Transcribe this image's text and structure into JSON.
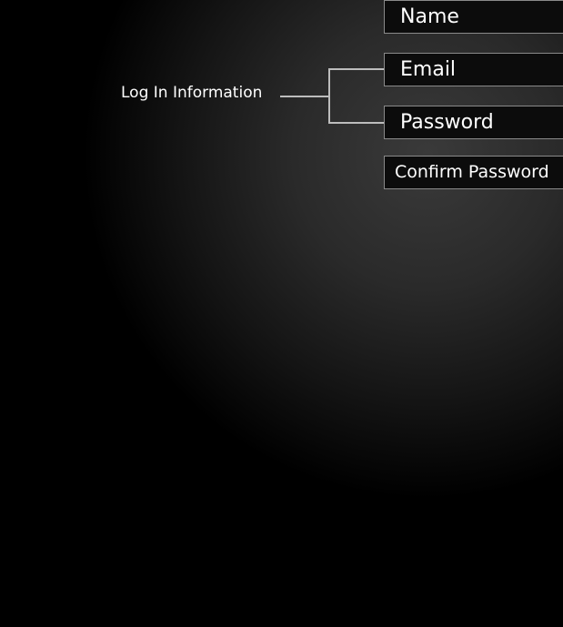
{
  "fields": [
    {
      "label": "Name"
    },
    {
      "label": "Email"
    },
    {
      "label": "Password"
    },
    {
      "label": "Confirm Password"
    }
  ],
  "group_label": "Log In Information"
}
